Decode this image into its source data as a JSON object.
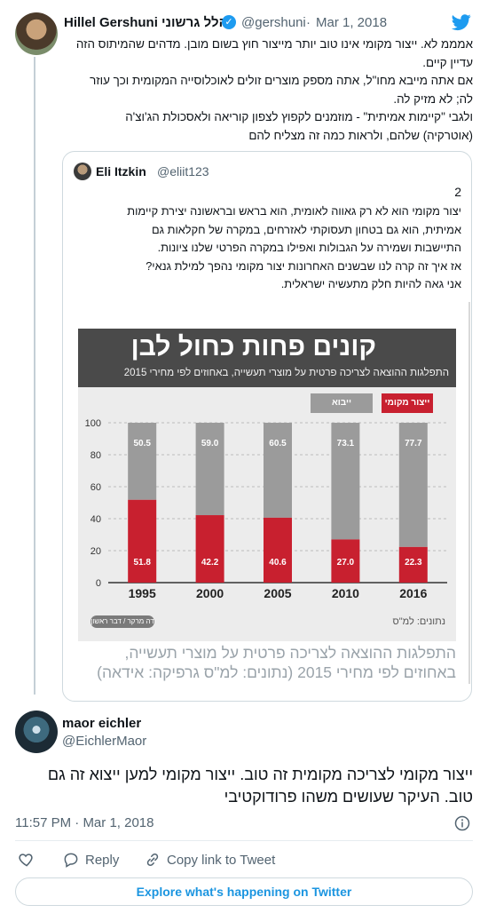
{
  "tweet": {
    "author_name": "Hillel Gershuni הלל גרשוני",
    "author_handle": "@gershuni",
    "dot": "·",
    "date": "Mar 1, 2018",
    "lines": [
      "אמממ לא. ייצור מקומי אינו טוב יותר מייצור חוץ בשום מובן. מדהים שהמיתוס הזה",
      "עדיין קיים.",
      "אם אתה מייבא מחו\"ל, אתה מספק מוצרים זולים לאוכלוסייה המקומית וכך עוזר",
      "לה; לא מזיק לה.",
      "ולגבי \"קיימות אמיתית\" - מוזמנים לקפוץ לצפון קוריאה ולאסכולת הג'וצ'ה",
      "(אוטרקיה) שלהם, ולראות כמה זה מצליח להם"
    ]
  },
  "quoted": {
    "author_name": "Eli Itzkin",
    "author_handle": "@eliit123",
    "number": "2",
    "lines": [
      "יצור מקומי הוא לא רק גאווה לאומית, הוא בראש ובראשונה יצירת קיימות",
      "אמיתית, הוא גם בטחון תעסוקתי לאזרחים, במקרה של חקלאות גם",
      "התיישבות ושמירה על הגבולות ואפילו במקרה הפרטי שלנו ציונות.",
      "אז איך זה קרה לנו שבשנים האחרונות יצור מקומי נהפך למילת גנאי?",
      "אני גאה להיות חלק מתעשיה ישראלית."
    ],
    "caption_line1": "התפלגות ההוצאה לצריכה פרטית על מוצרי תעשייה,",
    "caption_line2": "באחוזים לפי מחירי 2015 (נתונים: למ\"ס גרפיקה: אידאה)"
  },
  "chart_data": {
    "type": "bar",
    "stacked": true,
    "title": "קונים פחות כחול לבן",
    "subtitle": "התפלגות ההוצאה לצריכה פרטית על מוצרי תעשייה, באחוזים לפי מחירי 2015",
    "categories": [
      "1995",
      "2000",
      "2005",
      "2010",
      "2016"
    ],
    "series": [
      {
        "name": "ייצור מקומי",
        "color": "#c8202f",
        "values": [
          51.8,
          42.2,
          40.6,
          27.0,
          22.3
        ]
      },
      {
        "name": "ייבוא",
        "color": "#9b9b9b",
        "values": [
          50.5,
          59.0,
          60.5,
          73.1,
          77.7
        ]
      }
    ],
    "yticks": [
      "0",
      "20",
      "40",
      "60",
      "80",
      "100"
    ],
    "ylim": [
      0,
      100
    ],
    "source": "נתונים: למ\"ס",
    "logo": "דה מרקר / דבר ראשון",
    "legend_position": "top-right"
  },
  "reply": {
    "author_name": "maor eichler",
    "author_handle": "@EichlerMaor",
    "text": "ייצור מקומי לצריכה מקומית זה טוב. ייצור מקומי למען ייצוא זה גם טוב. העיקר שעושים משהו פרודוקטיבי",
    "time": "11:57 PM",
    "dot": "·",
    "date": "Mar 1, 2018"
  },
  "actions": {
    "reply_label": "Reply",
    "copy_label": "Copy link to Tweet",
    "explore_label": "Explore what's happening on Twitter"
  },
  "icons": [
    "twitter-bird-icon",
    "verified-badge-icon",
    "info-icon",
    "heart-icon",
    "reply-icon",
    "link-icon"
  ],
  "colors": {
    "accent": "#1b95e0",
    "verified": "#1d9bf0",
    "local": "#c8202f",
    "import": "#9b9b9b"
  }
}
